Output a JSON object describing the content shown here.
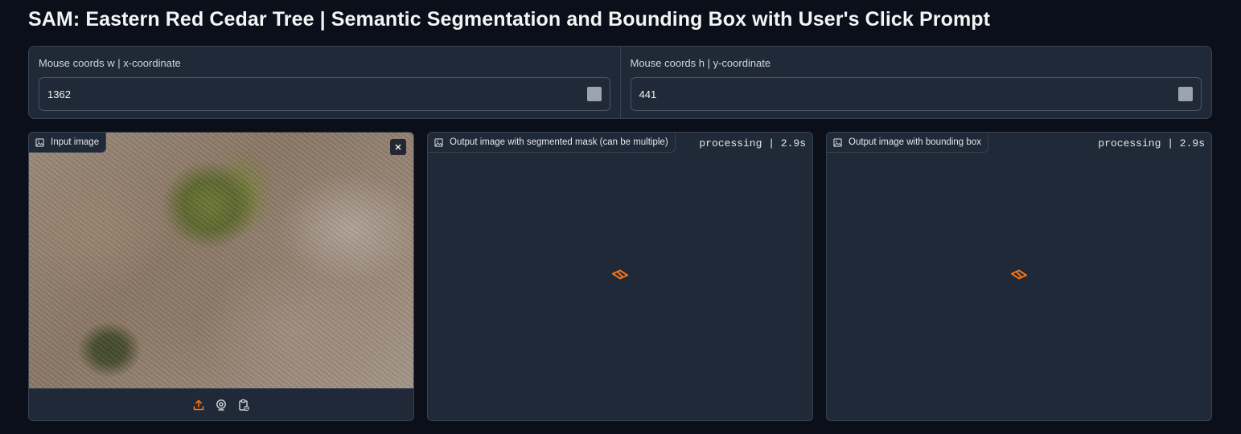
{
  "page": {
    "title": "SAM: Eastern Red Cedar Tree | Semantic Segmentation and Bounding Box with User's Click Prompt"
  },
  "coords": {
    "w": {
      "label": "Mouse coords w | x-coordinate",
      "value": "1362"
    },
    "h": {
      "label": "Mouse coords h | y-coordinate",
      "value": "441"
    }
  },
  "panels": {
    "input": {
      "label": "Input image"
    },
    "mask": {
      "label": "Output image with segmented mask (can be multiple)",
      "status": "processing | 2.9s"
    },
    "bbox": {
      "label": "Output image with bounding box",
      "status": "processing | 2.9s"
    }
  },
  "icons": {
    "image": "image-icon",
    "close": "close-icon",
    "upload": "upload-icon",
    "webcam": "webcam-icon",
    "clipboard": "clipboard-icon",
    "loader": "loader-icon"
  },
  "colors": {
    "background": "#0b0f19",
    "panel": "#1f2937",
    "border": "#374151",
    "accent": "#f97316"
  }
}
